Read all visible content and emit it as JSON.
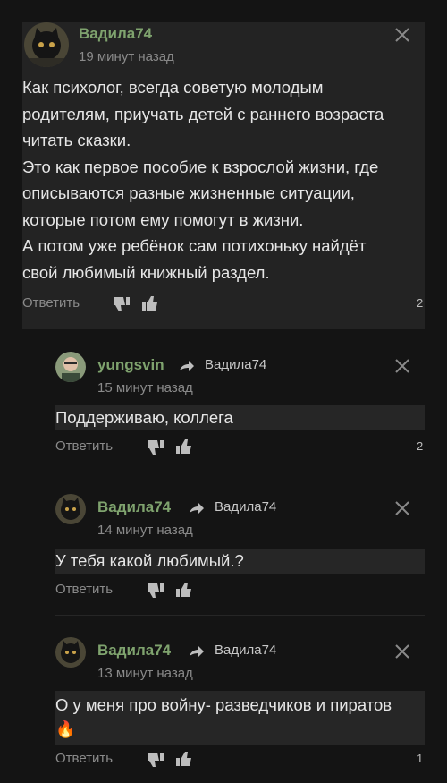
{
  "comments": [
    {
      "author": "Вадила74",
      "time": "19 минут назад",
      "lines": [
        "Как психолог, всегда советую молодым",
        "родителям, приучать детей с раннего возраста",
        "читать сказки.",
        "Это как первое пособие к взрослой жизни, где",
        "описываются разные жизненные ситуации,",
        "которые потом ему помогут в жизни.",
        "А потом уже ребёнок сам потихоньку найдёт",
        "свой любимый книжный раздел."
      ],
      "reply_label": "Ответить",
      "score": "2",
      "avatar_icon": "cat-avatar"
    },
    {
      "author": "yungsvin",
      "reply_to": "Вадила74",
      "time": "15 минут назад",
      "text": "Поддерживаю, коллега",
      "reply_label": "Ответить",
      "score": "2",
      "avatar_icon": "person-avatar"
    },
    {
      "author": "Вадила74",
      "reply_to": "Вадила74",
      "time": "14 минут назад",
      "text": "У тебя какой любимый.?",
      "reply_label": "Ответить",
      "score": "",
      "avatar_icon": "cat-avatar"
    },
    {
      "author": "Вадила74",
      "reply_to": "Вадила74",
      "time": "13 минут назад",
      "text": "О у меня про войну- разведчиков и пиратов",
      "emoji": "🔥",
      "reply_label": "Ответить",
      "score": "1",
      "avatar_icon": "cat-avatar"
    }
  ],
  "colors": {
    "background": "#141414",
    "card": "#232323",
    "author": "#7fa36e",
    "muted": "#8a8a8a"
  },
  "icons": [
    "close-icon",
    "thumbs-down-icon",
    "thumbs-up-icon",
    "reply-arrow-icon"
  ]
}
